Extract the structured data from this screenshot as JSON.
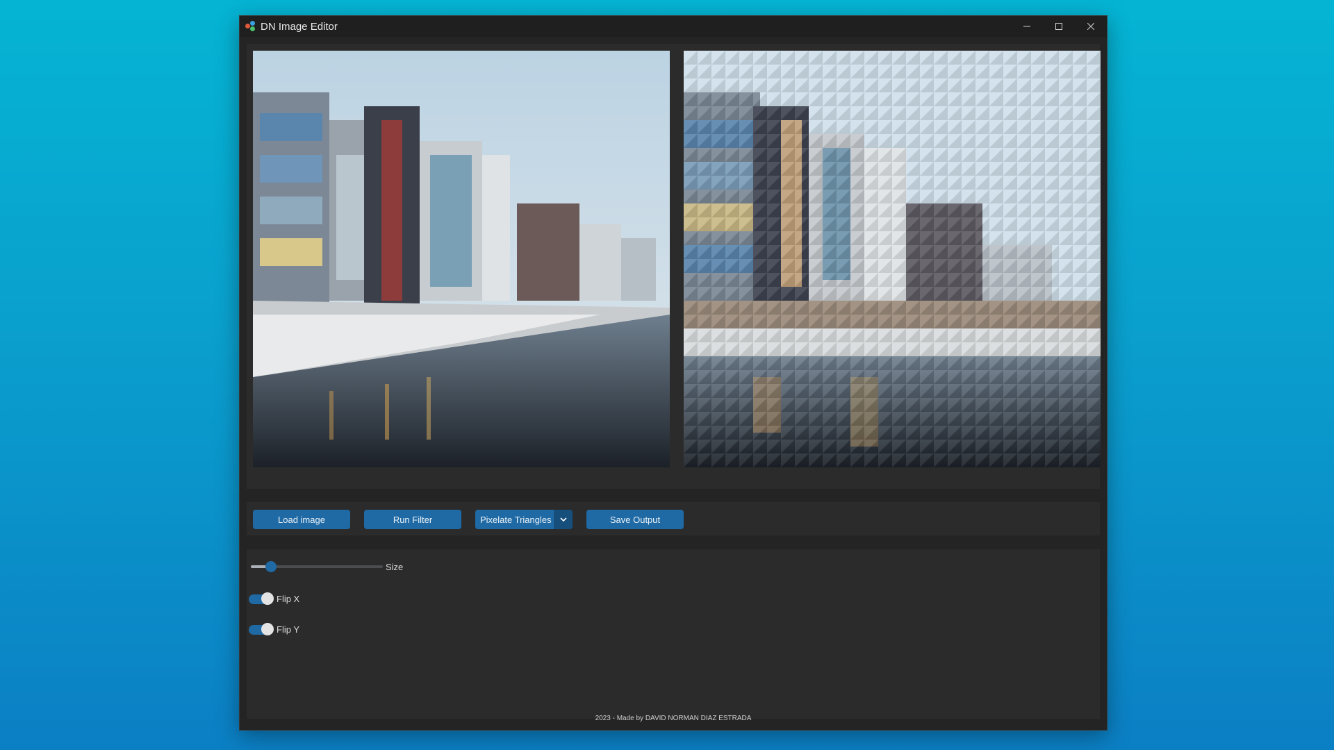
{
  "window": {
    "title": "DN Image Editor",
    "controls": [
      "minimize",
      "maximize",
      "close"
    ]
  },
  "images": {
    "original_alt": "city waterfront photo",
    "filtered_alt": "pixelated triangles output"
  },
  "toolbar": {
    "load_label": "Load image",
    "run_label": "Run Filter",
    "filter_selected": "Pixelate Triangles",
    "save_label": "Save Output"
  },
  "options": {
    "size_label": "Size",
    "size_value": 0.15,
    "flip_x_label": "Flip X",
    "flip_x_on": true,
    "flip_y_label": "Flip Y",
    "flip_y_on": true
  },
  "footer": {
    "text": "2023 - Made by DAVID NORMAN DIAZ ESTRADA"
  },
  "colors": {
    "accent": "#1f6aa5",
    "accent_dark": "#174f7c",
    "window_bg": "#242424",
    "panel_bg": "#2b2b2b"
  }
}
